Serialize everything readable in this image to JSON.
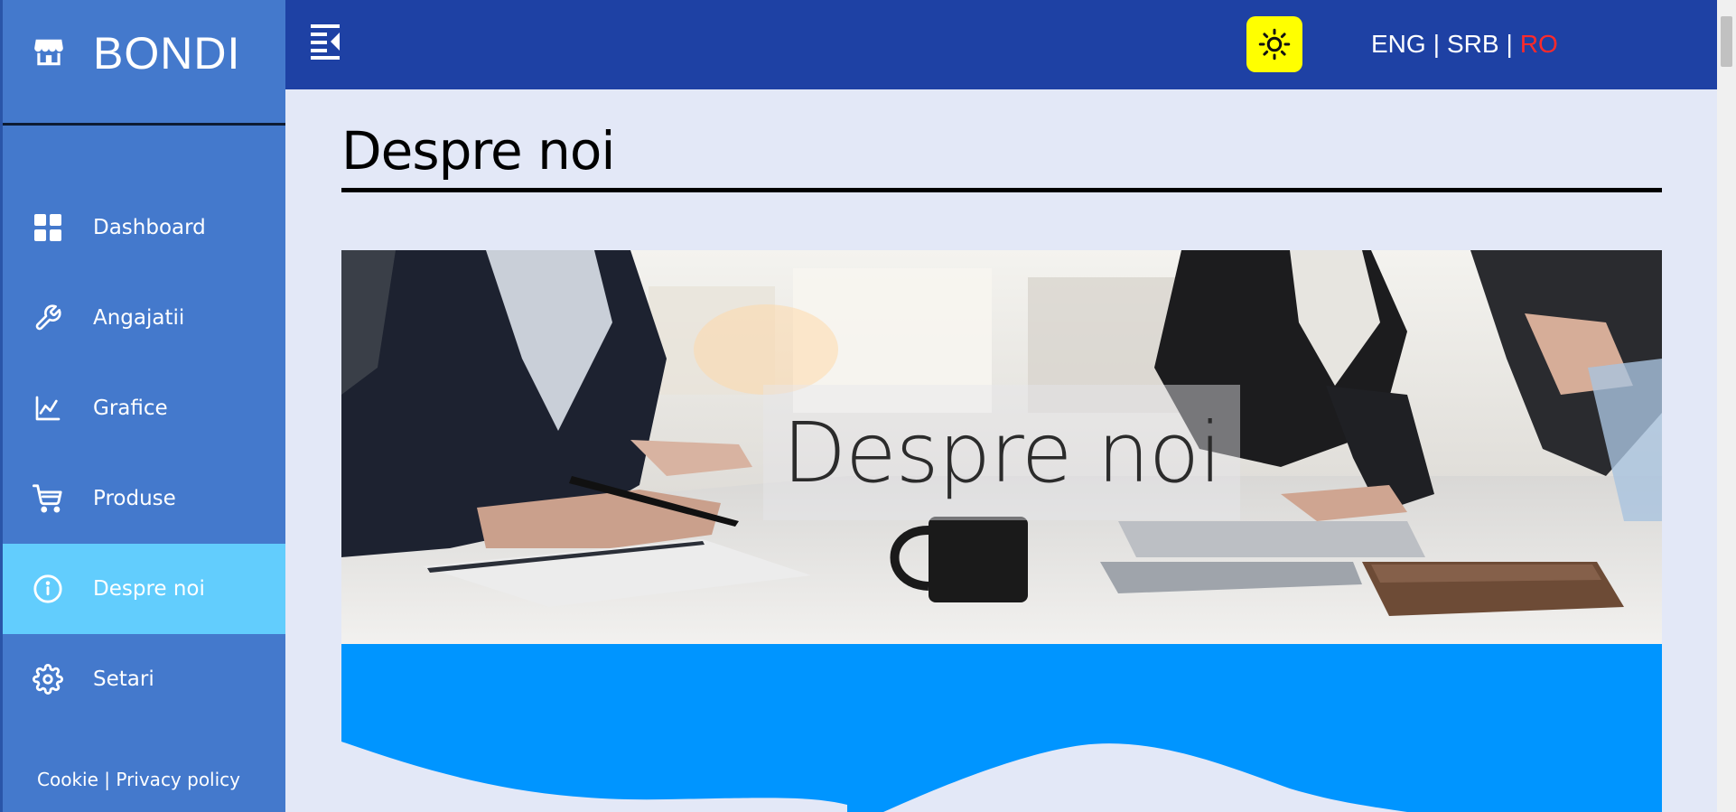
{
  "brand": {
    "name": "BONDI",
    "icon": "shop-icon"
  },
  "nav": {
    "items": [
      {
        "label": "Dashboard",
        "icon": "dashboard-grid-icon",
        "active": false
      },
      {
        "label": "Angajatii",
        "icon": "wrench-icon",
        "active": false
      },
      {
        "label": "Grafice",
        "icon": "line-chart-icon",
        "active": false
      },
      {
        "label": "Produse",
        "icon": "cart-icon",
        "active": false
      },
      {
        "label": "Despre noi",
        "icon": "info-icon",
        "active": true
      },
      {
        "label": "Setari",
        "icon": "gear-icon",
        "active": false
      }
    ]
  },
  "footer": {
    "cookie": "Cookie",
    "separator": "|",
    "privacy": "Privacy policy"
  },
  "topbar": {
    "menu_icon": "menu-collapse-icon",
    "theme_icon": "sun-icon",
    "languages": [
      {
        "label": "ENG",
        "active": false
      },
      {
        "label": "SRB",
        "active": false
      },
      {
        "label": "RO",
        "active": true
      }
    ],
    "lang_separator": "|"
  },
  "main": {
    "title": "Despre noi",
    "hero_caption": "Despre noi"
  },
  "colors": {
    "sidebar": "#4479cc",
    "sidebar_active": "#62cdfd",
    "topbar": "#1e41a4",
    "background": "#e3e8f7",
    "theme_button": "#ffff00",
    "active_language": "#ff2a2a",
    "wave_section": "#0095ff"
  }
}
